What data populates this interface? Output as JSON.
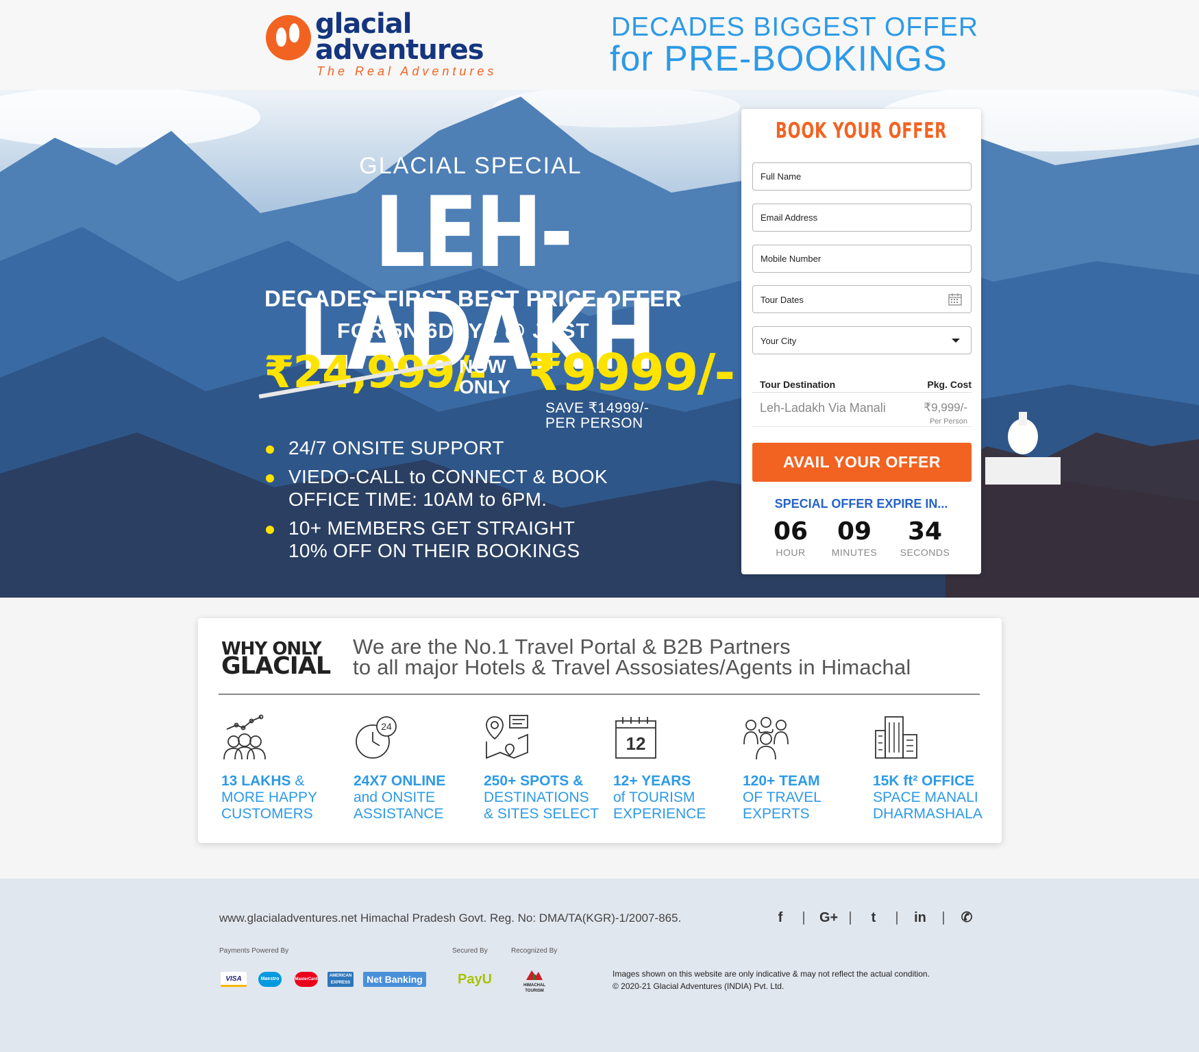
{
  "header": {
    "logo_line1": "glacial",
    "logo_line2": "adventures",
    "tagline": "The Real Adventures",
    "offer_line1": "DECADES BIGGEST OFFER",
    "offer_line2": "for PRE-BOOKINGS"
  },
  "hero": {
    "special": "GLACIAL SPECIAL",
    "destination": "LEH-LADAKH",
    "subheading": "DECADES FIRST BEST PRICE OFFER",
    "duration": "FOR 5N/6DAYS @ JUST",
    "old_price": "₹24,999/-",
    "now_line1": "NOW",
    "now_line2": "ONLY",
    "new_price": "₹9999/-",
    "save_line1": "SAVE ₹14999/-",
    "save_line2": "PER PERSON",
    "bullets": [
      {
        "line1": "24/7 ONSITE SUPPORT",
        "line2": ""
      },
      {
        "line1": "VIEDO-CALL to CONNECT & BOOK",
        "line2": "OFFICE TIME: 10AM to 6PM."
      },
      {
        "line1": "10+ MEMBERS GET STRAIGHT",
        "line2": "10% OFF ON THEIR BOOKINGS"
      }
    ]
  },
  "form": {
    "title": "BOOK YOUR OFFER",
    "full_name_placeholder": "Full Name",
    "email_placeholder": "Email Address",
    "mobile_placeholder": "Mobile Number",
    "tour_dates_placeholder": "Tour Dates",
    "city_selected": "Your City",
    "table_header_destination": "Tour Destination",
    "table_header_cost": "Pkg. Cost",
    "row_destination": "Leh-Ladakh Via Manali",
    "row_cost": "₹9,999/-",
    "row_cost_unit": "Per Person",
    "submit_label": "AVAIL YOUR OFFER",
    "expire_label": "SPECIAL OFFER EXPIRE IN...",
    "timer": {
      "hours": "06",
      "hours_label": "HOUR",
      "minutes": "09",
      "minutes_label": "MINUTES",
      "seconds": "34",
      "seconds_label": "SECONDS"
    }
  },
  "why": {
    "label1": "WHY ONLY",
    "label2": "GLACIAL",
    "desc_line1": "We are the No.1 Travel Portal & B2B Partners",
    "desc_line2": "to all major Hotels & Travel Assosiates/Agents in Himachal",
    "features": [
      {
        "icon": "customers-growth-icon",
        "bold": "13 LAKHS",
        "rest": " &",
        "line2": "MORE HAPPY",
        "line3": "CUSTOMERS"
      },
      {
        "icon": "clock-24-icon",
        "bold": "24X7 ONLINE",
        "rest": "",
        "line2": "and ONSITE",
        "line3": "ASSISTANCE"
      },
      {
        "icon": "map-pin-icon",
        "bold": "250+ SPOTS &",
        "rest": "",
        "line2": "DESTINATIONS",
        "line3": "& SITES SELECT"
      },
      {
        "icon": "calendar-icon",
        "bold": "12+ YEARS",
        "rest": "",
        "line2": "of TOURISM",
        "line3": "EXPERIENCE"
      },
      {
        "icon": "team-icon",
        "bold": "120+ TEAM",
        "rest": "",
        "line2": "OF TRAVEL",
        "line3": "EXPERTS"
      },
      {
        "icon": "office-building-icon",
        "bold": "15K ft² OFFICE",
        "rest": "",
        "line2": "SPACE MANALI",
        "line3": "DHARMASHALA"
      }
    ],
    "calendar_day": "12",
    "clock_number": "24"
  },
  "footer": {
    "registration": "www.glacialadventures.net Himachal Pradesh Govt. Reg. No: DMA/TA(KGR)-1/2007-865.",
    "socials": [
      "facebook-icon",
      "google-plus-icon",
      "twitter-icon",
      "linkedin-icon",
      "whatsapp-icon"
    ],
    "social_glyphs": [
      "f",
      "G+",
      "t",
      "in",
      "✆"
    ],
    "payments_label": "Payments Powered By",
    "secured_label": "Secured By",
    "recognized_label": "Recognized By",
    "payment_methods": [
      "VISA",
      "Maestro",
      "MasterCard",
      "AMERICAN EXPRESS",
      "Net Banking"
    ],
    "secured_by": "PayU",
    "recognized_by": "HIMACHAL TOURISM",
    "disclaimer_line1": "Images shown on this website are only indicative & may not reflect the actual condition.",
    "disclaimer_line2": "© 2020-21 Glacial Adventures (INDIA) Pvt. Ltd."
  },
  "colors": {
    "brand_orange": "#f26322",
    "brand_navy": "#15357e",
    "accent_blue": "#2d9ae6",
    "highlight_yellow": "#ffe300"
  }
}
